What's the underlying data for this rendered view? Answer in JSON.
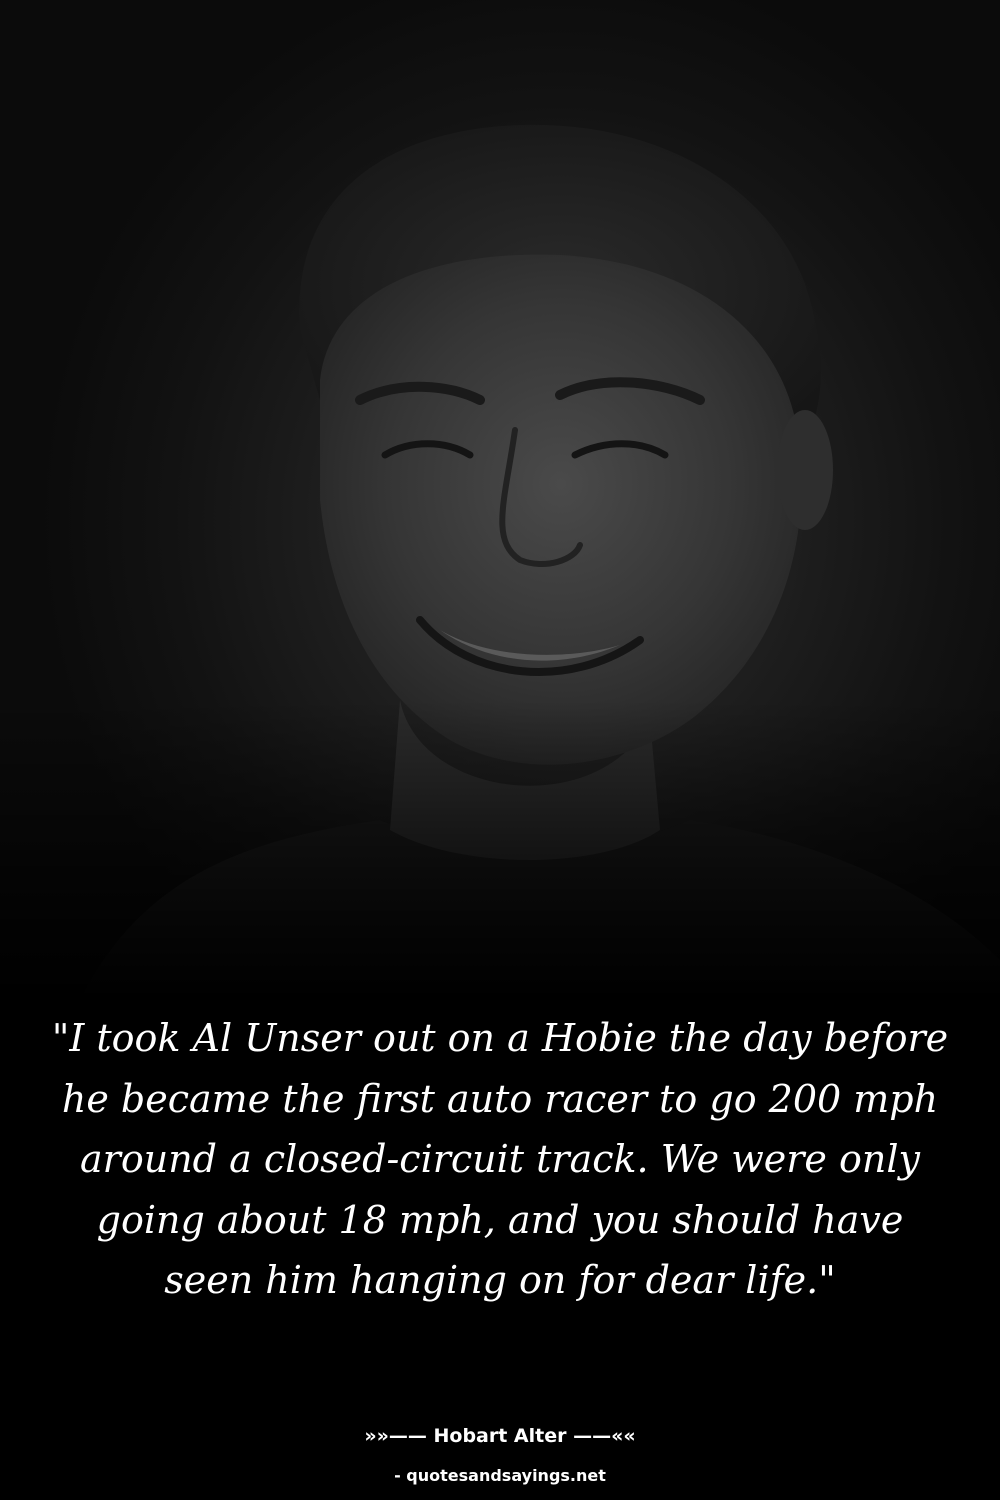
{
  "quote": {
    "text": "\"I took Al Unser out on a Hobie the day before he became the first auto racer to go 200 mph around a closed-circuit track. We were only going about 18 mph, and you should have seen him hanging on for dear life.\""
  },
  "attribution": {
    "author_line": "»»—— Hobart Alter ——««",
    "source_line": "- quotesandsayings.net"
  },
  "colors": {
    "background": "#000000",
    "text": "#ffffff"
  }
}
